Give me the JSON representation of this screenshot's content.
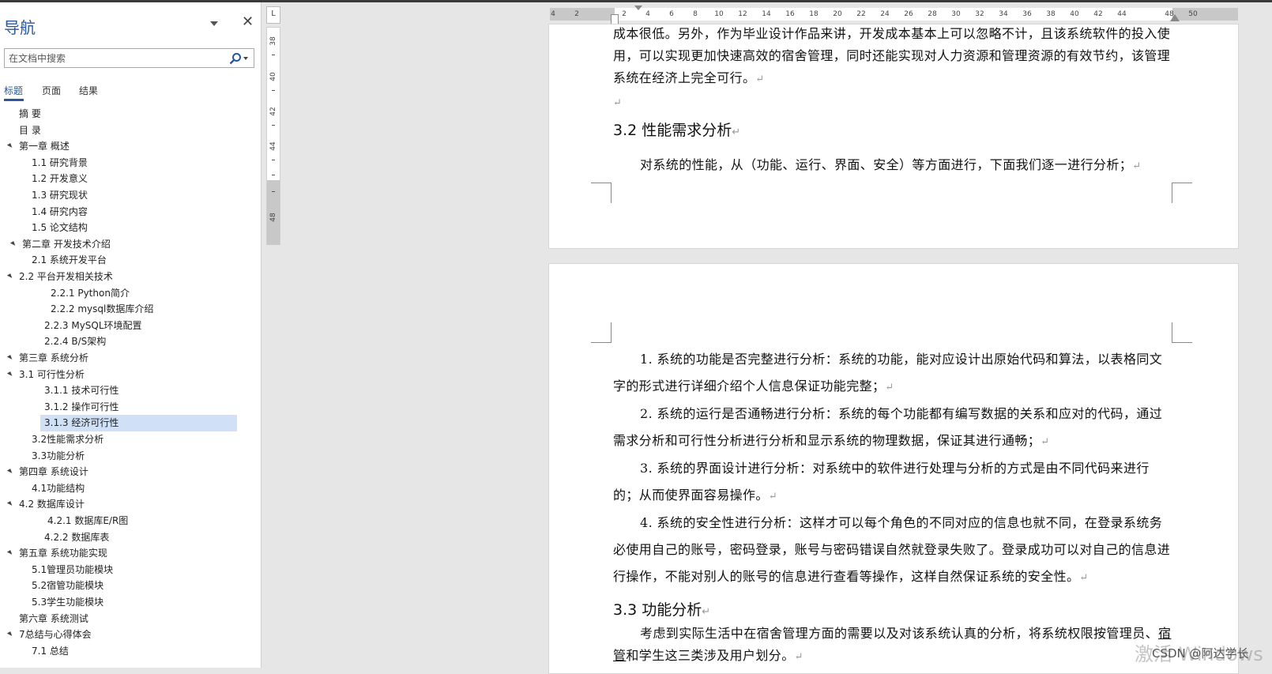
{
  "nav": {
    "title": "导航",
    "close": "✕",
    "search_placeholder": "在文档中搜索",
    "tabs": [
      "标题",
      "页面",
      "结果"
    ],
    "items": [
      "摘  要",
      "目  录",
      "第一章 概述",
      "1.1 研究背景",
      "1.2 开发意义",
      "1.3 研究现状",
      "1.4 研究内容",
      "1.5 论文结构",
      "第二章 开发技术介绍",
      "2.1 系统开发平台",
      "2.2 平台开发相关技术",
      "2.2.1   Python简介",
      "2.2.2   mysql数据库介绍",
      "2.2.3   MySQL环境配置",
      "2.2.4   B/S架构",
      "第三章 系统分析",
      "3.1 可行性分析",
      "3.1.1 技术可行性",
      "3.1.2 操作可行性",
      "3.1.3 经济可行性",
      "3.2性能需求分析",
      "3.3功能分析",
      "第四章 系统设计",
      "4.1功能结构",
      "4.2 数据库设计",
      "4.2.1 数据库E/R图",
      "4.2.2 数据库表",
      "第五章 系统功能实现",
      "5.1管理员功能模块",
      "5.2宿管功能模块",
      "5.3学生功能模块",
      "第六章 系统测试",
      "7总结与心得体会",
      "7.1 总结"
    ]
  },
  "ruler": {
    "corner": "L",
    "h_numbers": [
      "4",
      "2",
      "2",
      "4",
      "6",
      "8",
      "10",
      "12",
      "14",
      "16",
      "18",
      "20",
      "22",
      "24",
      "26",
      "28",
      "30",
      "32",
      "34",
      "36",
      "38",
      "40",
      "42",
      "44",
      "48",
      "50"
    ],
    "v_numbers": [
      "38",
      "40",
      "42",
      "44",
      "48"
    ]
  },
  "doc": {
    "p1": "成本很低。另外，作为毕业设计作品来讲，开发成本基本上可以忽略不计，且该系统软件的投入使用，可以实现更加快速高效的宿舍管理，同时还能实现对人力资源和管理资源的有效节约，该管理系统在经济上完全可行。",
    "h32": "3.2 性能需求分析",
    "p2": "对系统的性能，从（功能、运行、界面、安全）等方面进行，下面我们逐一进行分析；",
    "l1": "1. 系统的功能是否完整进行分析：系统的功能，能对应设计出原始代码和算法，以表格同文字的形式进行详细介绍个人信息保证功能完整；",
    "l2": "2. 系统的运行是否通畅进行分析：系统的每个功能都有编写数据的关系和应对的代码，通过需求分析和可行性分析进行分析和显示系统的物理数据，保证其进行通畅；",
    "l3": "3. 系统的界面设计进行分析：对系统中的软件进行处理与分析的方式是由不同代码来进行的；从而使界面容易操作。",
    "l4": "4. 系统的安全性进行分析：这样才可以每个角色的不同对应的信息也就不同，在登录系统务必使用自己的账号，密码登录，账号与密码错误自然就登录失败了。登录成功可以对自己的信息进行操作，不能对别人的账号的信息进行查看等操作，这样自然保证系统的安全性。",
    "h33": "3.3 功能分析",
    "p3a": "考虑到实际生活中在宿舍管理方面的需要以及对该系统认真的分析，将系统权限按管理员、",
    "p3b": "宿管",
    "p3c": "和学生这三类涉及用户划分。",
    "mark": "↵"
  },
  "watermark": "激活 Windows",
  "csdn": "CSDN @阿达学长"
}
